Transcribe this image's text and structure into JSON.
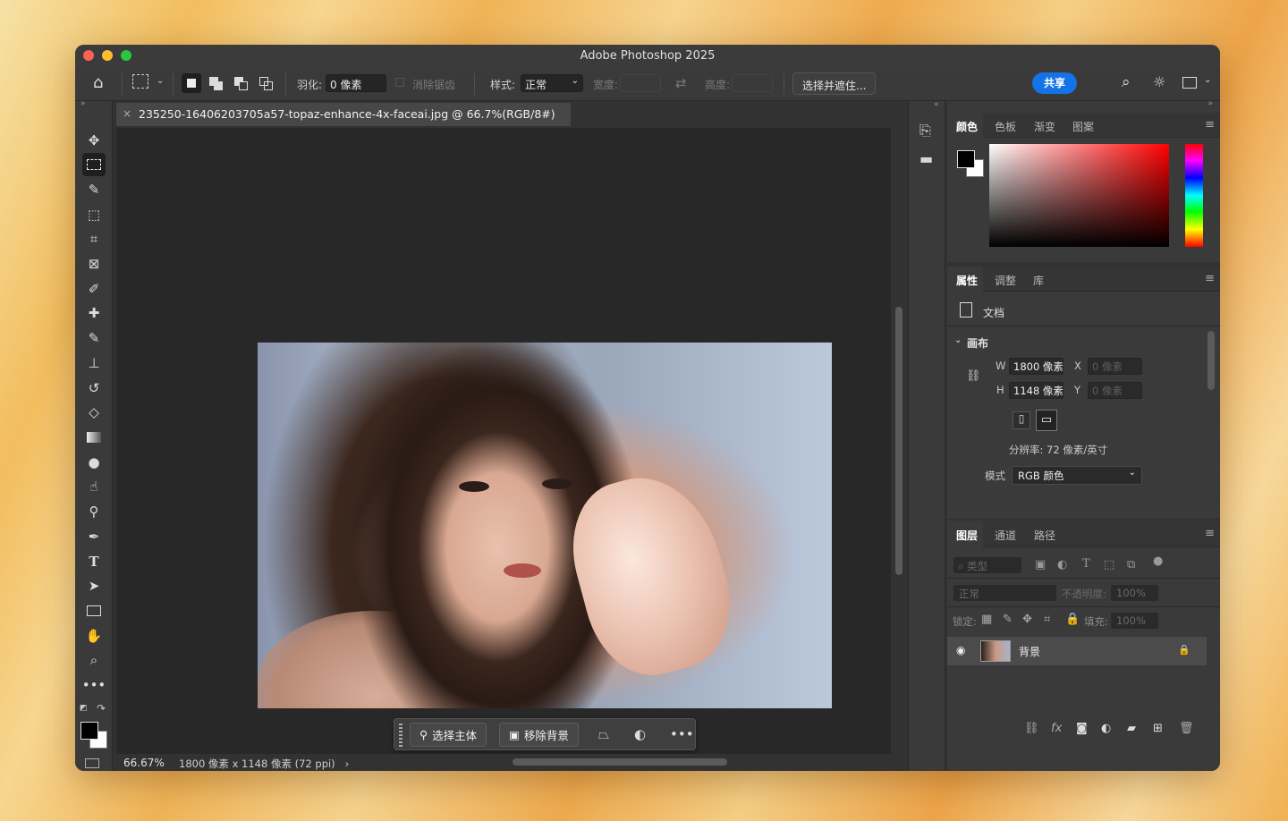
{
  "window": {
    "title": "Adobe Photoshop 2025"
  },
  "options_bar": {
    "feather_label": "羽化:",
    "feather_value": "0 像素",
    "antialias_label": "消除锯齿",
    "style_label": "样式:",
    "style_value": "正常",
    "width_label": "宽度:",
    "height_label": "高度:",
    "select_mask_button": "选择并遮住...",
    "share_button": "共享"
  },
  "document": {
    "tab_label": "235250-16406203705a57-topaz-enhance-4x-faceai.jpg @ 66.7%(RGB/8#)",
    "zoom": "66.67%",
    "info": "1800 像素 x 1148 像素 (72 ppi)",
    "info_arrow": "›"
  },
  "contextual_bar": {
    "select_subject": "选择主体",
    "remove_bg": "移除背景"
  },
  "color_panel": {
    "tabs": [
      "颜色",
      "色板",
      "渐变",
      "图案"
    ],
    "foreground": "#000000",
    "background": "#ffffff"
  },
  "properties_panel": {
    "tabs": [
      "属性",
      "调整",
      "库"
    ],
    "doc_label": "文档",
    "canvas_header": "画布",
    "w_label": "W",
    "w_value": "1800 像素",
    "h_label": "H",
    "h_value": "1148 像素",
    "x_label": "X",
    "x_value": "0 像素",
    "y_label": "Y",
    "y_value": "0 像素",
    "resolution": "分辨率: 72 像素/英寸",
    "mode_label": "模式",
    "mode_value": "RGB 颜色"
  },
  "layers_panel": {
    "tabs": [
      "图层",
      "通道",
      "路径"
    ],
    "filter_placeholder": "类型",
    "blend_mode": "正常",
    "opacity_label": "不透明度:",
    "opacity_value": "100%",
    "lock_label": "锁定:",
    "fill_label": "填充:",
    "fill_value": "100%",
    "layers": [
      {
        "name": "背景"
      }
    ]
  },
  "icons": {
    "tools": [
      "move-icon",
      "marquee-icon",
      "quick-select-icon",
      "object-select-icon",
      "crop-icon",
      "frame-icon",
      "eyedropper-icon",
      "healing-brush-icon",
      "brush-icon",
      "stamp-icon",
      "history-brush-icon",
      "eraser-icon",
      "gradient-icon",
      "blur-icon",
      "smudge-icon",
      "dodge-icon",
      "pen-icon",
      "type-icon",
      "path-select-icon",
      "rectangle-icon",
      "hand-icon",
      "zoom-icon",
      "more-tools-icon"
    ]
  }
}
